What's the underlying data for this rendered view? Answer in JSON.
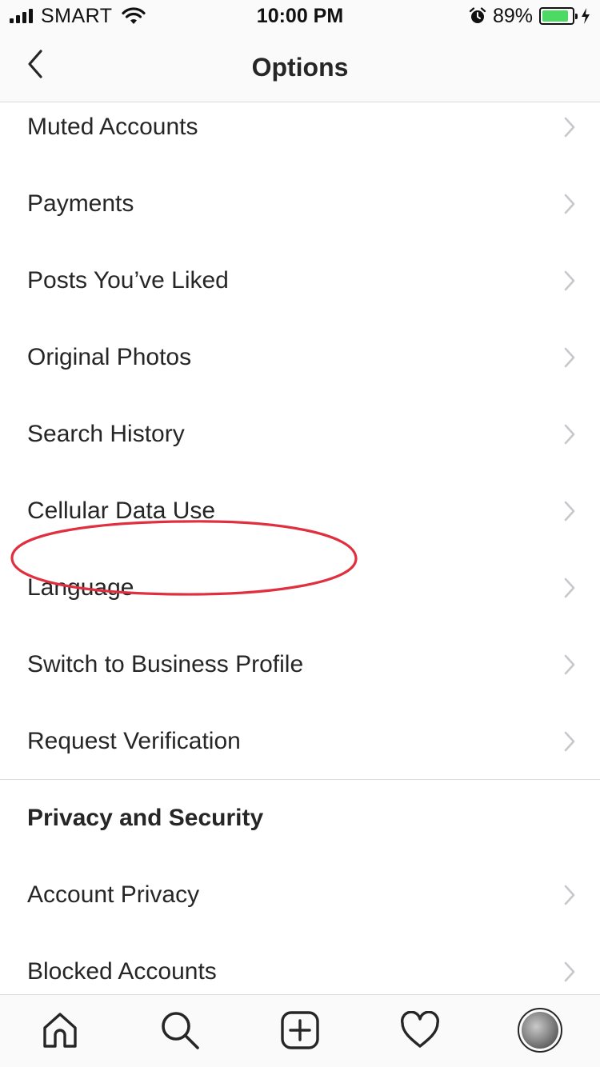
{
  "status_bar": {
    "carrier": "SMART",
    "time": "10:00 PM",
    "battery_percent": "89%",
    "battery_level": 0.89,
    "battery_color": "#4cd964",
    "icons": [
      "signal-icon",
      "wifi-icon",
      "alarm-icon",
      "battery-icon",
      "charging-icon"
    ]
  },
  "nav": {
    "title": "Options",
    "back_icon": "chevron-left-icon"
  },
  "menu": {
    "items": [
      {
        "label": "Muted Accounts"
      },
      {
        "label": "Payments"
      },
      {
        "label": "Posts You’ve Liked"
      },
      {
        "label": "Original Photos"
      },
      {
        "label": "Search History"
      },
      {
        "label": "Cellular Data Use"
      },
      {
        "label": "Language"
      },
      {
        "label": "Switch to Business Profile",
        "highlighted": true
      },
      {
        "label": "Request Verification"
      }
    ],
    "section_header": "Privacy and Security",
    "privacy_items": [
      {
        "label": "Account Privacy"
      },
      {
        "label": "Blocked Accounts"
      }
    ],
    "highlight_color": "#e0303f"
  },
  "tab_bar": {
    "tabs": [
      "home-icon",
      "search-icon",
      "new-post-icon",
      "activity-heart-icon",
      "profile-avatar"
    ]
  }
}
